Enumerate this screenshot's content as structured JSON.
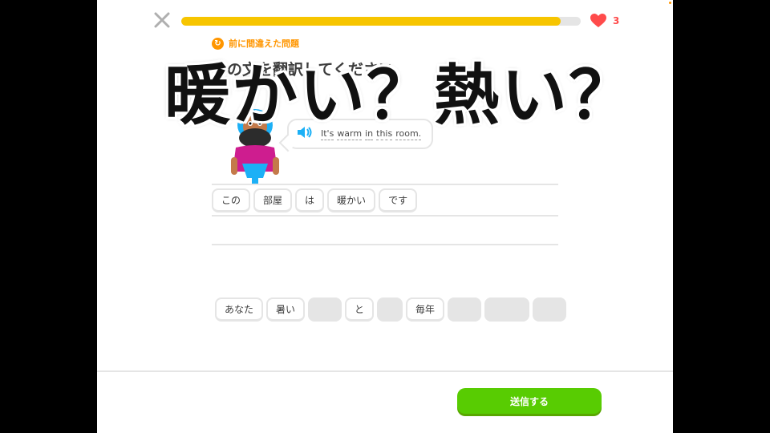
{
  "progress_fraction": 0.95,
  "hearts": {
    "count": "3",
    "color": "#ff4b4b"
  },
  "mistake_label": "前に間違えた問題",
  "instruction": "この文を翻訳してください",
  "overlay_title": "暖かい？熱い？",
  "prompt": {
    "speaker_icon": "speaker-icon",
    "words": [
      "It's",
      "warm",
      "in",
      "this",
      "room."
    ]
  },
  "answer_tiles": [
    "この",
    "部屋",
    "は",
    "暖かい",
    "です"
  ],
  "word_bank": [
    {
      "label": "あなた",
      "used": false
    },
    {
      "label": "暑い",
      "used": false
    },
    {
      "label": "",
      "used": true
    },
    {
      "label": "と",
      "used": false
    },
    {
      "label": "",
      "used": true
    },
    {
      "label": "毎年",
      "used": false
    },
    {
      "label": "",
      "used": true
    },
    {
      "label": "",
      "used": true
    },
    {
      "label": "",
      "used": true
    }
  ],
  "submit_label": "送信する",
  "colors": {
    "accent": "#58cc02",
    "progress": "#f7c500",
    "mistake": "#ff9600"
  }
}
